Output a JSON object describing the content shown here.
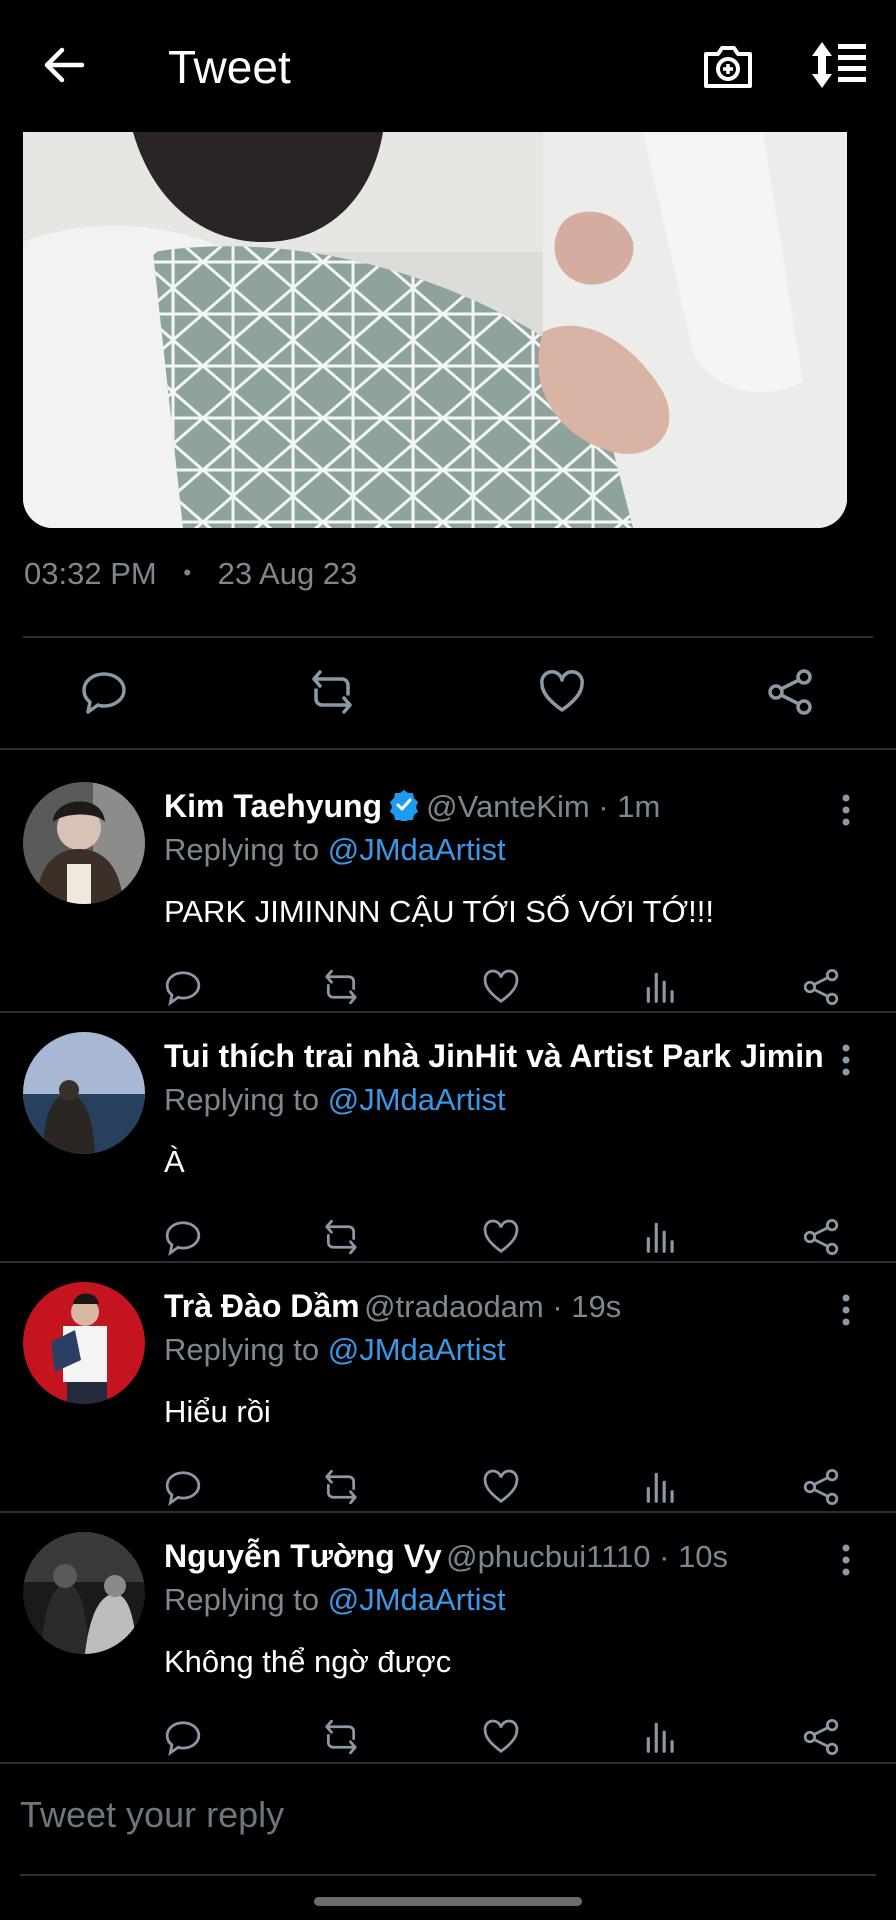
{
  "header": {
    "title": "Tweet",
    "icons": [
      "back-arrow-icon",
      "camera-plus-icon",
      "sort-icon"
    ]
  },
  "tweet": {
    "time": "03:32 PM",
    "separator": "•",
    "date": "23 Aug 23"
  },
  "colors": {
    "background": "#000000",
    "muted": "#7d8790",
    "link": "#3a98e6",
    "divider": "#2a2f34",
    "icon": "#8b98a5"
  },
  "replies": [
    {
      "name": "Kim Taehyung",
      "verified": true,
      "handle": "@VanteKim · 1m",
      "replying_prefix": "Replying to",
      "replying_to": "@JMdaArtist",
      "text": "PARK JIMINNN CẬU TỚI SỐ VỚI TỚ!!!"
    },
    {
      "name": "Tui thích trai nhà JinHit và Artist Park Jimin ...",
      "verified": false,
      "handle": "",
      "replying_prefix": "Replying to",
      "replying_to": "@JMdaArtist",
      "text": "À"
    },
    {
      "name": "Trà Đào Dầm",
      "verified": false,
      "handle": "@tradaodam · 19s",
      "replying_prefix": "Replying to",
      "replying_to": "@JMdaArtist",
      "text": "Hiểu rồi"
    },
    {
      "name": "Nguyễn Tường Vy",
      "verified": false,
      "handle": "@phucbui1110 · 10s",
      "replying_prefix": "Replying to",
      "replying_to": "@JMdaArtist",
      "text": "Không thể ngờ được"
    }
  ],
  "composer": {
    "placeholder": "Tweet your reply"
  }
}
